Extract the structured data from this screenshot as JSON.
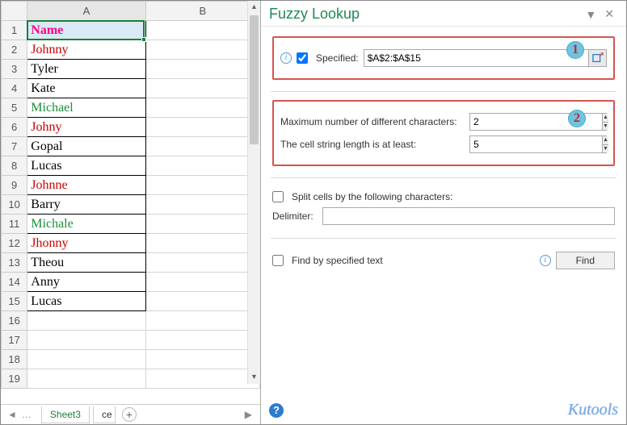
{
  "sheet": {
    "columns": [
      "A",
      "B"
    ],
    "header_row": 1,
    "header_label": "Name",
    "header_color": "#ff007f",
    "selected_cell": "A1",
    "rows": [
      {
        "n": 1,
        "text": "Name",
        "color": "#ff007f",
        "bold": true
      },
      {
        "n": 2,
        "text": "Johnny",
        "color": "#cc0000"
      },
      {
        "n": 3,
        "text": "Tyler",
        "color": "#000000"
      },
      {
        "n": 4,
        "text": "Kate",
        "color": "#000000"
      },
      {
        "n": 5,
        "text": "Michael",
        "color": "#1a8f3a"
      },
      {
        "n": 6,
        "text": "Johny",
        "color": "#cc0000"
      },
      {
        "n": 7,
        "text": "Gopal",
        "color": "#000000"
      },
      {
        "n": 8,
        "text": "Lucas",
        "color": "#000000"
      },
      {
        "n": 9,
        "text": "Johnne",
        "color": "#cc0000"
      },
      {
        "n": 10,
        "text": "Barry",
        "color": "#000000"
      },
      {
        "n": 11,
        "text": "Michale",
        "color": "#1a8f3a"
      },
      {
        "n": 12,
        "text": "Jhonny",
        "color": "#cc0000"
      },
      {
        "n": 13,
        "text": "Theou",
        "color": "#000000"
      },
      {
        "n": 14,
        "text": "Anny",
        "color": "#000000"
      },
      {
        "n": 15,
        "text": "Lucas",
        "color": "#000000"
      },
      {
        "n": 16,
        "text": "",
        "color": ""
      },
      {
        "n": 17,
        "text": "",
        "color": ""
      },
      {
        "n": 18,
        "text": "",
        "color": ""
      },
      {
        "n": 19,
        "text": "",
        "color": ""
      }
    ],
    "tabs": {
      "nav_first": "◄",
      "nav_more": "…",
      "active": "Sheet3",
      "next_partial": "ce",
      "add": "+"
    }
  },
  "pane": {
    "title": "Fuzzy Lookup",
    "close": "✕",
    "drop": "▼",
    "section1": {
      "badge": "1",
      "specified_label": "Specified:",
      "specified_checked": true,
      "range_value": "$A$2:$A$15"
    },
    "section2": {
      "badge": "2",
      "max_diff_label": "Maximum number of different characters:",
      "max_diff_value": "2",
      "min_len_label": "The cell string length is at least:",
      "min_len_value": "5"
    },
    "section3": {
      "split_label": "Split cells by the following characters:",
      "split_checked": false,
      "delimiter_label": "Delimiter:",
      "delimiter_value": ""
    },
    "section4": {
      "findtext_label": "Find by specified text",
      "findtext_checked": false,
      "find_button": "Find"
    },
    "footer": {
      "help": "?",
      "brand": "Kutools"
    }
  }
}
